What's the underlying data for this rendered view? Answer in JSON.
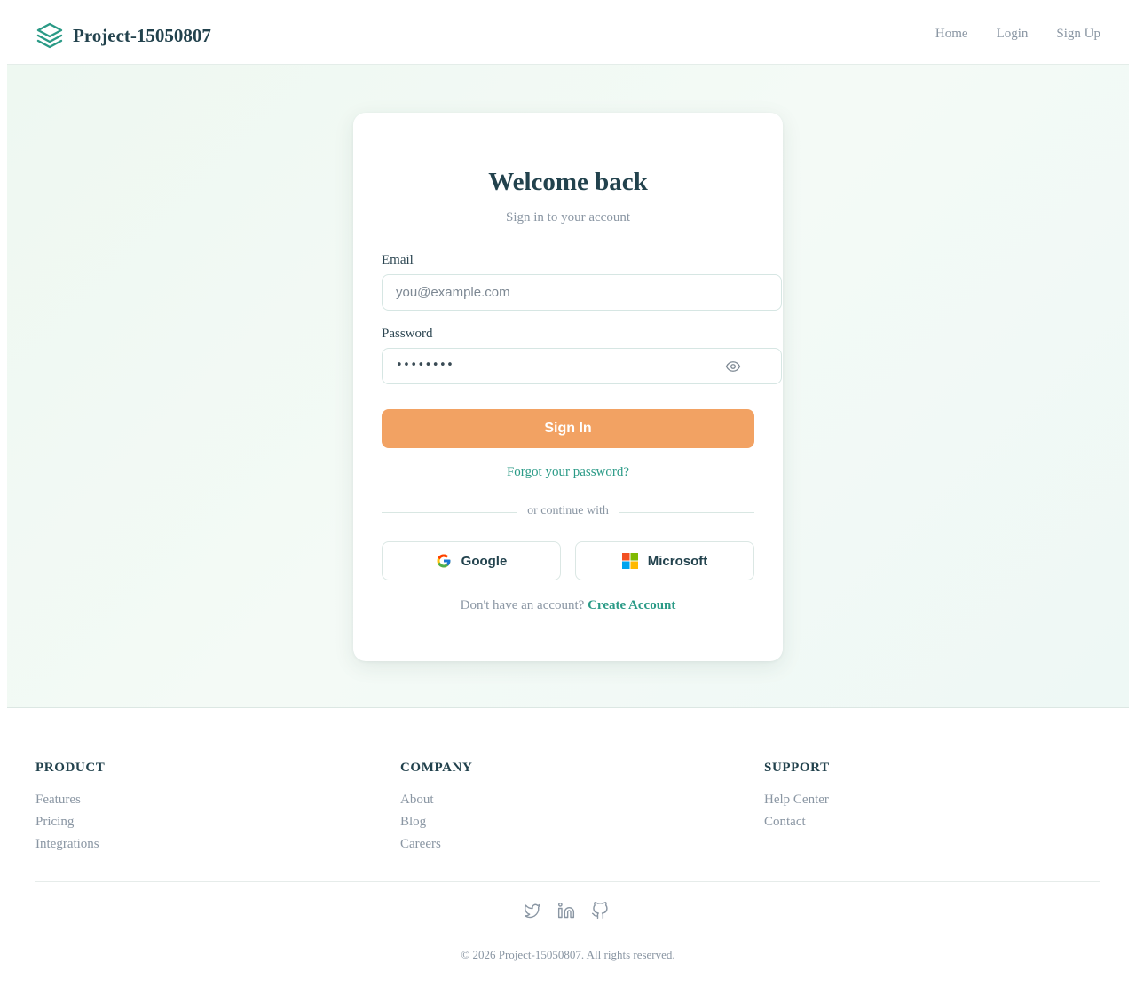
{
  "header": {
    "brand_name": "Project-15050807",
    "nav": [
      "Home",
      "Login",
      "Sign Up"
    ]
  },
  "card": {
    "title": "Welcome back",
    "subtitle": "Sign in to your account",
    "email_label": "Email",
    "email_placeholder": "you@example.com",
    "password_label": "Password",
    "password_value": "••••••••",
    "signin_label": "Sign In",
    "forgot_label": "Forgot your password?",
    "divider_text": "or continue with",
    "google_label": "Google",
    "microsoft_label": "Microsoft",
    "no_account_text": "Don't have an account?",
    "create_account_label": "Create Account"
  },
  "footer": {
    "columns": [
      {
        "heading": "PRODUCT",
        "links": [
          "Features",
          "Pricing",
          "Integrations"
        ]
      },
      {
        "heading": "COMPANY",
        "links": [
          "About",
          "Blog",
          "Careers"
        ]
      },
      {
        "heading": "SUPPORT",
        "links": [
          "Help Center",
          "Contact"
        ]
      }
    ],
    "social_icons": [
      "twitter-icon",
      "linkedin-icon",
      "github-icon"
    ],
    "copyright": "© 2026 Project-15050807. All rights reserved."
  },
  "colors": {
    "accent": "#2a9a86",
    "primary_button": "#f2a263",
    "heading": "#22424d",
    "muted": "#8a96a3"
  }
}
